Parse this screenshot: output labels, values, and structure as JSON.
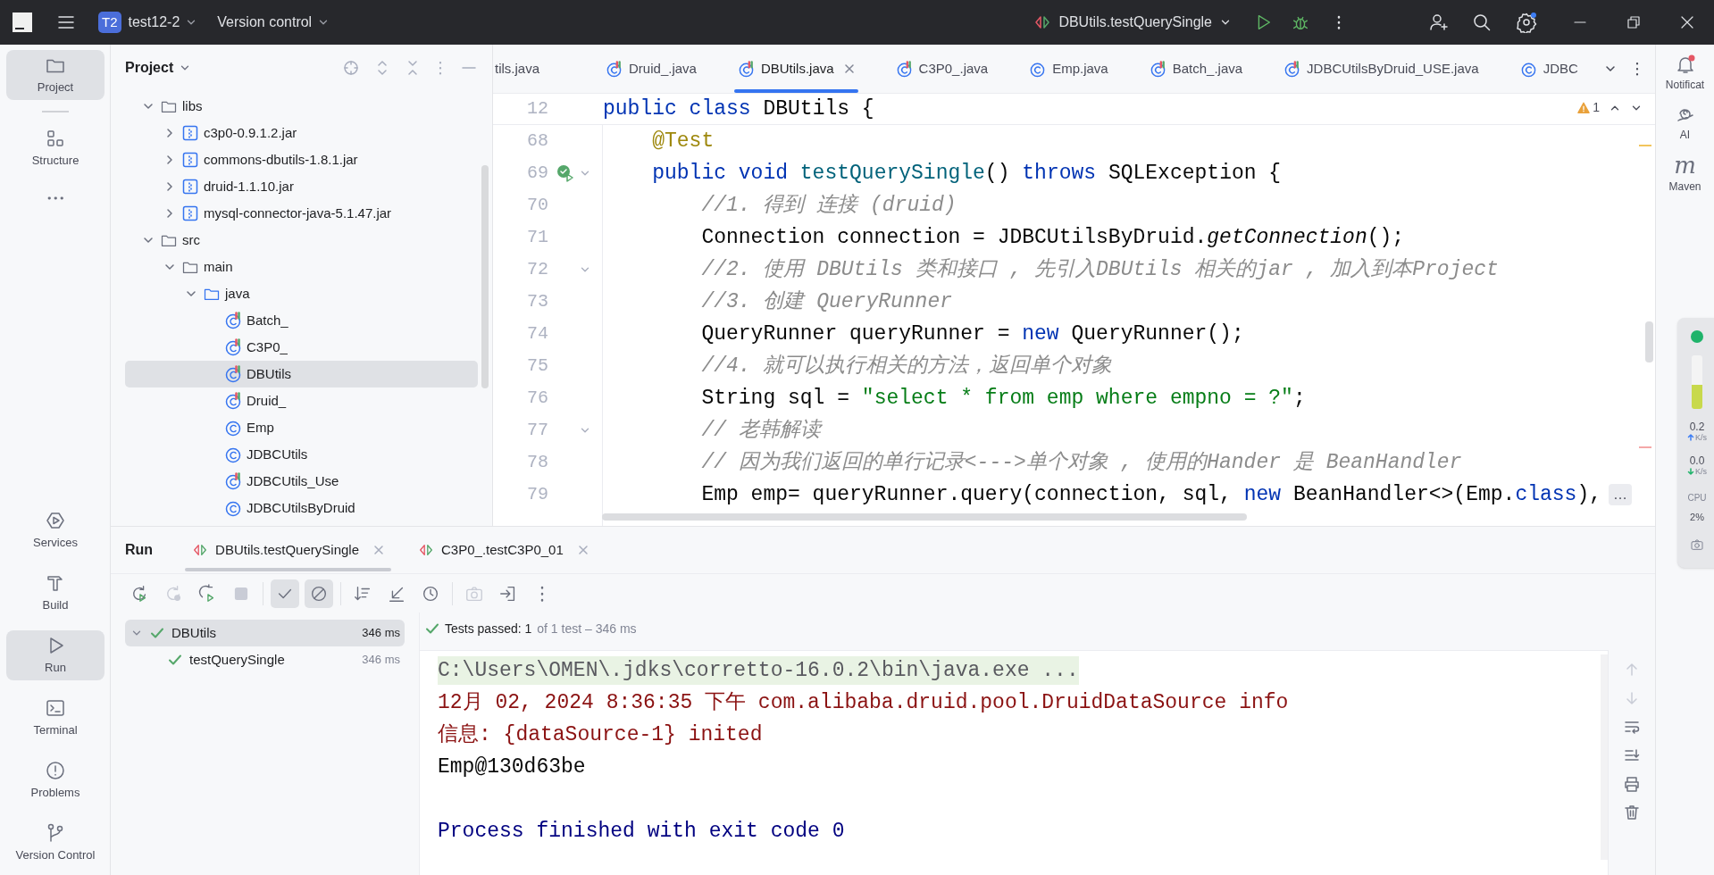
{
  "title_bar": {
    "project_badge": "T2",
    "project": "test12-2",
    "vcs": "Version control",
    "run_config": "DBUtils.testQuerySingle"
  },
  "left_toolbar": {
    "top": [
      {
        "label": "Project",
        "kind": "folder",
        "selected": true
      },
      {
        "label": "Structure",
        "kind": "structure",
        "selected": false
      }
    ],
    "bottom": [
      {
        "label": "Services",
        "kind": "services",
        "selected": false
      },
      {
        "label": "Build",
        "kind": "build",
        "selected": false
      },
      {
        "label": "Run",
        "kind": "run",
        "selected": true
      },
      {
        "label": "Terminal",
        "kind": "terminal",
        "selected": false
      },
      {
        "label": "Problems",
        "kind": "problems",
        "selected": false
      },
      {
        "label": "Version Control",
        "kind": "vcs",
        "selected": false
      }
    ]
  },
  "project_panel": {
    "title": "Project",
    "tree": [
      {
        "label": "libs",
        "kind": "folder",
        "expanded": true,
        "selected": false,
        "children": [
          {
            "label": "c3p0-0.9.1.2.jar",
            "kind": "jar",
            "expanded": false,
            "selected": false
          },
          {
            "label": "commons-dbutils-1.8.1.jar",
            "kind": "jar",
            "expanded": false,
            "selected": false
          },
          {
            "label": "druid-1.1.10.jar",
            "kind": "jar",
            "expanded": false,
            "selected": false
          },
          {
            "label": "mysql-connector-java-5.1.47.jar",
            "kind": "jar",
            "expanded": false,
            "selected": false
          }
        ]
      },
      {
        "label": "src",
        "kind": "folder",
        "expanded": true,
        "selected": false,
        "children": [
          {
            "label": "main",
            "kind": "folder",
            "expanded": true,
            "selected": false,
            "children": [
              {
                "label": "java",
                "kind": "source",
                "expanded": true,
                "selected": false,
                "children": [
                  {
                    "label": "Batch_",
                    "kind": "runnable",
                    "selected": false
                  },
                  {
                    "label": "C3P0_",
                    "kind": "runnable",
                    "selected": false
                  },
                  {
                    "label": "DBUtils",
                    "kind": "runnable",
                    "selected": true
                  },
                  {
                    "label": "Druid_",
                    "kind": "runnable",
                    "selected": false
                  },
                  {
                    "label": "Emp",
                    "kind": "class",
                    "selected": false
                  },
                  {
                    "label": "JDBCUtils",
                    "kind": "class",
                    "selected": false
                  },
                  {
                    "label": "JDBCUtils_Use",
                    "kind": "runnable",
                    "selected": false
                  },
                  {
                    "label": "JDBCUtilsByDruid",
                    "kind": "class",
                    "selected": false
                  }
                ]
              }
            ]
          }
        ]
      }
    ]
  },
  "editor": {
    "tabs": [
      {
        "label": "tils.java",
        "selected": false
      },
      {
        "label": "Druid_.java",
        "kind": "runnable",
        "selected": false
      },
      {
        "label": "DBUtils.java",
        "kind": "runnable",
        "selected": true
      },
      {
        "label": "C3P0_.java",
        "kind": "runnable",
        "selected": false
      },
      {
        "label": "Emp.java",
        "kind": "class",
        "selected": false
      },
      {
        "label": "Batch_.java",
        "kind": "runnable",
        "selected": false
      },
      {
        "label": "JDBCUtilsByDruid_USE.java",
        "kind": "runnable",
        "selected": false
      },
      {
        "label": "JDBC",
        "kind": "class",
        "selected": false
      }
    ],
    "warning_count": "1",
    "sticky_line": {
      "number": "12",
      "tokens": [
        {
          "kind": "keyword",
          "text": "public class"
        },
        {
          "kind": "plain",
          "text": " DBUtils {"
        }
      ]
    },
    "lines": [
      {
        "number": "68",
        "tokens": [
          {
            "kind": "annotation",
            "text": "@Test"
          }
        ]
      },
      {
        "number": "69",
        "run_icon": true,
        "fold": true,
        "tokens": [
          {
            "kind": "keyword",
            "text": "public void"
          },
          {
            "kind": "declaration",
            "text": " testQuerySingle"
          },
          {
            "kind": "plain",
            "text": "() "
          },
          {
            "kind": "keyword",
            "text": "throws"
          },
          {
            "kind": "plain",
            "text": " SQLException {"
          }
        ],
        "children": [
          {
            "number": "70",
            "tokens": [
              {
                "kind": "comment",
                "text": "//1. 得到 连接 (druid)"
              }
            ]
          },
          {
            "number": "71",
            "tokens": [
              {
                "kind": "plain",
                "text": "Connection connection = JDBCUtilsByDruid."
              },
              {
                "kind": "static_call",
                "text": "getConnection"
              },
              {
                "kind": "plain",
                "text": "();"
              }
            ]
          },
          {
            "number": "72",
            "fold": true,
            "tokens": [
              {
                "kind": "comment",
                "text": "//2. 使用 DBUtils 类和接口 , 先引入DBUtils 相关的jar , 加入到本Project"
              }
            ]
          },
          {
            "number": "73",
            "tokens": [
              {
                "kind": "comment",
                "text": "//3. 创建 QueryRunner"
              }
            ]
          },
          {
            "number": "74",
            "tokens": [
              {
                "kind": "plain",
                "text": "QueryRunner queryRunner = "
              },
              {
                "kind": "keyword",
                "text": "new"
              },
              {
                "kind": "plain",
                "text": " QueryRunner();"
              }
            ]
          },
          {
            "number": "75",
            "tokens": [
              {
                "kind": "comment",
                "text": "//4. 就可以执行相关的方法，返回单个对象"
              }
            ]
          },
          {
            "number": "76",
            "tokens": [
              {
                "kind": "plain",
                "text": "String sql = "
              },
              {
                "kind": "string",
                "text": "\"select * from emp where empno = ?\""
              },
              {
                "kind": "plain",
                "text": ";"
              }
            ]
          },
          {
            "number": "77",
            "fold": true,
            "tokens": [
              {
                "kind": "comment",
                "text": "// 老韩解读"
              }
            ]
          },
          {
            "number": "78",
            "tokens": [
              {
                "kind": "comment",
                "text": "// 因为我们返回的单行记录<--->单个对象 , 使用的Hander 是 BeanHandler"
              }
            ]
          },
          {
            "number": "79",
            "fold_hint": "…",
            "tokens": [
              {
                "kind": "plain",
                "text": "Emp emp= queryRunner.query(connection, sql, "
              },
              {
                "kind": "keyword",
                "text": "new"
              },
              {
                "kind": "plain",
                "text": " BeanHandler<>(Emp."
              },
              {
                "kind": "keyword",
                "text": "class"
              },
              {
                "kind": "plain",
                "text": "),"
              }
            ]
          }
        ]
      }
    ]
  },
  "right_toolbar": [
    {
      "label": "Notificat",
      "kind": "bell",
      "badge": true
    },
    {
      "label": "AI",
      "kind": "spiral"
    },
    {
      "label": "Maven",
      "glyph": "m"
    }
  ],
  "monitor": {
    "gauge": {
      "level": 0.45
    },
    "upload": "0.2",
    "upload_unit": "K/s",
    "download": "0.0",
    "download_unit": "K/s",
    "cpu_label": "CPU",
    "cpu": "2%"
  },
  "run_panel": {
    "title": "Run",
    "tabs": [
      {
        "label": "DBUtils.testQuerySingle",
        "selected": true
      },
      {
        "label": "C3P0_.testC3P0_01",
        "selected": false
      }
    ],
    "toolbar": [
      {
        "kind": "rerun",
        "disabled": false,
        "toggled": false
      },
      {
        "kind": "rerun_failed",
        "disabled": true,
        "toggled": false
      },
      {
        "kind": "auto_rerun",
        "disabled": false,
        "toggled": false
      },
      {
        "kind": "stop",
        "disabled": true,
        "toggled": false
      },
      {
        "kind": "show_passed",
        "disabled": false,
        "toggled": true
      },
      {
        "kind": "show_ignored",
        "disabled": false,
        "toggled": true
      },
      {
        "kind": "sort",
        "disabled": false,
        "toggled": false
      },
      {
        "kind": "import",
        "disabled": false,
        "toggled": false
      },
      {
        "kind": "history",
        "disabled": false,
        "toggled": false
      },
      {
        "kind": "camera",
        "disabled": true,
        "toggled": false
      },
      {
        "kind": "export",
        "disabled": false,
        "toggled": false
      },
      {
        "kind": "more",
        "disabled": false,
        "toggled": false
      }
    ],
    "tests": [
      {
        "name": "DBUtils",
        "time": "346 ms",
        "passed": true,
        "expanded": true,
        "selected": true,
        "children": [
          {
            "name": "testQuerySingle",
            "time": "346 ms",
            "passed": true,
            "selected": false
          }
        ]
      }
    ],
    "status": {
      "passed": true,
      "summary": "Tests passed: 1",
      "detail": "of 1 test – 346 ms"
    },
    "console": [
      {
        "kind": "command",
        "text": "C:\\Users\\OMEN\\.jdks\\corretto-16.0.2\\bin\\java.exe ..."
      },
      {
        "kind": "stderr",
        "text": "12月 02, 2024 8:36:35 下午 com.alibaba.druid.pool.DruidDataSource info"
      },
      {
        "kind": "stderr",
        "text": "信息: {dataSource-1} inited"
      },
      {
        "kind": "stdout",
        "text": "Emp@130d63be"
      },
      {
        "kind": "system",
        "text": "Process finished with exit code 0",
        "blank_before": true
      }
    ],
    "console_actions": [
      {
        "kind": "up",
        "disabled": true
      },
      {
        "kind": "down",
        "disabled": true
      },
      {
        "kind": "wrap",
        "disabled": false
      },
      {
        "kind": "scroll_end",
        "disabled": false
      },
      {
        "kind": "print",
        "disabled": false
      },
      {
        "kind": "trash",
        "disabled": false
      }
    ]
  }
}
